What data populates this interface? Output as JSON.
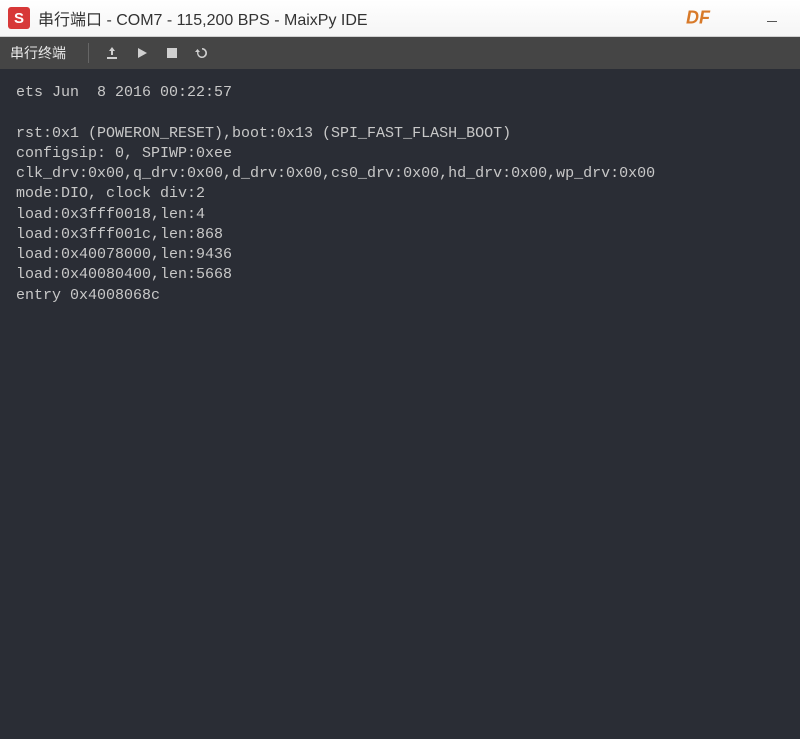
{
  "titlebar": {
    "app_icon_letter": "S",
    "title": "串行端口 - COM7 - 115,200 BPS - MaixPy IDE",
    "badge": "DF"
  },
  "toolbar": {
    "label": "串行终端"
  },
  "terminal": {
    "lines": [
      "ets Jun  8 2016 00:22:57",
      "",
      "rst:0x1 (POWERON_RESET),boot:0x13 (SPI_FAST_FLASH_BOOT)",
      "configsip: 0, SPIWP:0xee",
      "clk_drv:0x00,q_drv:0x00,d_drv:0x00,cs0_drv:0x00,hd_drv:0x00,wp_drv:0x00",
      "mode:DIO, clock div:2",
      "load:0x3fff0018,len:4",
      "load:0x3fff001c,len:868",
      "load:0x40078000,len:9436",
      "load:0x40080400,len:5668",
      "entry 0x4008068c"
    ]
  }
}
